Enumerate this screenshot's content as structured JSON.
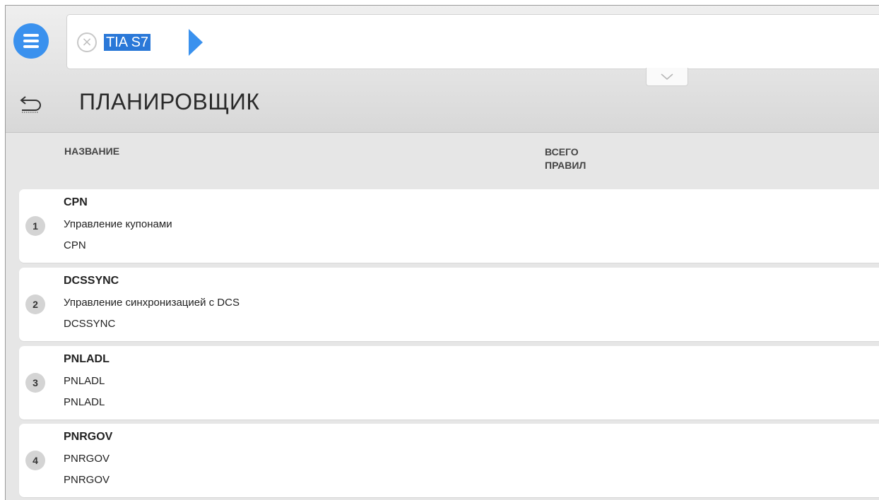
{
  "search": {
    "chip_label": "TIA S7"
  },
  "header": {
    "title": "ПЛАНИРОВЩИК"
  },
  "table": {
    "columns": {
      "name": "НАЗВАНИЕ",
      "total_line1": "ВСЕГО",
      "total_line2": "ПРАВИЛ"
    },
    "rows": [
      {
        "num": "1",
        "code": "CPN",
        "description": "Управление купонами",
        "sub": "CPN"
      },
      {
        "num": "2",
        "code": "DCSSYNC",
        "description": "Управление синхронизацией с DCS",
        "sub": "DCSSYNC"
      },
      {
        "num": "3",
        "code": "PNLADL",
        "description": "PNLADL",
        "sub": "PNLADL"
      },
      {
        "num": "4",
        "code": "PNRGOV",
        "description": "PNRGOV",
        "sub": "PNRGOV"
      }
    ]
  },
  "colors": {
    "accent": "#3a91ee",
    "selection": "#2a78d8",
    "background": "#e6e6e6"
  },
  "icons": {
    "menu": "hamburger-menu-icon",
    "clear": "clear-circle-icon",
    "run": "play-arrow-icon",
    "expand": "chevron-down-icon",
    "back": "back-arrow-icon"
  }
}
